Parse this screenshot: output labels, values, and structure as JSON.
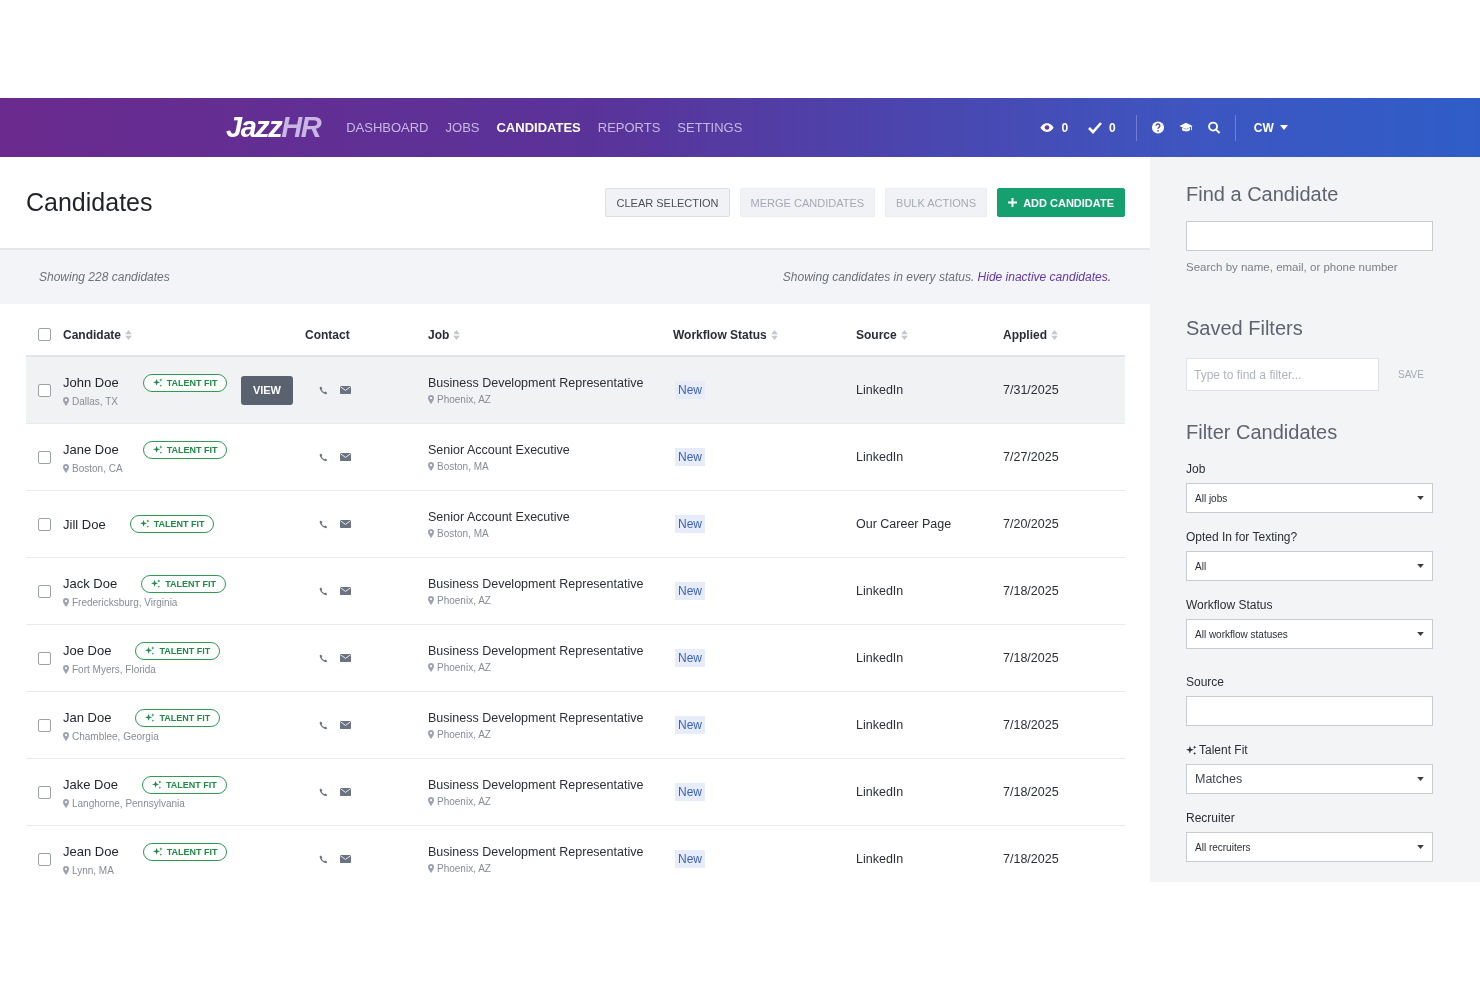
{
  "nav": {
    "logo": {
      "main": "Jazz",
      "accent": "HR"
    },
    "items": [
      {
        "label": "DASHBOARD",
        "selected": false
      },
      {
        "label": "JOBS",
        "selected": false
      },
      {
        "label": "CANDIDATES",
        "selected": true
      },
      {
        "label": "REPORTS",
        "selected": false
      },
      {
        "label": "SETTINGS",
        "selected": false
      }
    ],
    "counters": [
      {
        "kind": "eye",
        "count": "0"
      },
      {
        "kind": "check",
        "count": "0"
      }
    ],
    "tools": [
      {
        "kind": "help"
      },
      {
        "kind": "cap"
      },
      {
        "kind": "search"
      }
    ],
    "user": "CW"
  },
  "page": {
    "title": "Candidates",
    "actions": [
      {
        "label": "CLEAR SELECTION",
        "kind": "default",
        "disabled": false
      },
      {
        "label": "MERGE CANDIDATES",
        "kind": "default",
        "disabled": true
      },
      {
        "label": "BULK ACTIONS",
        "kind": "default",
        "disabled": true
      },
      {
        "label": "ADD CANDIDATE",
        "kind": "primary",
        "disabled": false
      }
    ],
    "count_text": "Showing 228 candidates",
    "status_note": "Showing candidates in every status.",
    "status_link": "Hide inactive candidates."
  },
  "table": {
    "select_all": {
      "checked": false
    },
    "columns": [
      {
        "label": "Candidate",
        "sortable": true
      },
      {
        "label": "Contact",
        "sortable": false
      },
      {
        "label": "Job",
        "sortable": true
      },
      {
        "label": "Workflow Status",
        "sortable": true
      },
      {
        "label": "Source",
        "sortable": true
      },
      {
        "label": "Applied",
        "sortable": true
      }
    ],
    "rows": [
      {
        "checked": false,
        "hovered": true,
        "name": "John Doe",
        "location": "Dallas, TX",
        "badge": "TALENT FIT",
        "action": "VIEW",
        "job": "Business Development Representative",
        "job_location": "Phoenix, AZ",
        "status": "New",
        "source": "LinkedIn",
        "applied": "7/31/2025"
      },
      {
        "checked": false,
        "hovered": false,
        "name": "Jane Doe",
        "location": "Boston, CA",
        "badge": "TALENT FIT",
        "job": "Senior Account Executive",
        "job_location": "Boston, MA",
        "status": "New",
        "source": "LinkedIn",
        "applied": "7/27/2025"
      },
      {
        "checked": false,
        "hovered": false,
        "name": "Jill Doe",
        "badge": "TALENT FIT",
        "job": "Senior Account Executive",
        "job_location": "Boston, MA",
        "status": "New",
        "source": "Our Career Page",
        "applied": "7/20/2025"
      },
      {
        "checked": false,
        "hovered": false,
        "name": "Jack Doe",
        "location": "Fredericksburg, Virginia",
        "badge": "TALENT FIT",
        "job": "Business Development Representative",
        "job_location": "Phoenix, AZ",
        "status": "New",
        "source": "LinkedIn",
        "applied": "7/18/2025"
      },
      {
        "checked": false,
        "hovered": false,
        "name": "Joe Doe",
        "location": "Fort Myers, Florida",
        "badge": "TALENT FIT",
        "job": "Business Development Representative",
        "job_location": "Phoenix, AZ",
        "status": "New",
        "source": "LinkedIn",
        "applied": "7/18/2025"
      },
      {
        "checked": false,
        "hovered": false,
        "name": "Jan Doe",
        "location": "Chamblee, Georgia",
        "badge": "TALENT FIT",
        "job": "Business Development Representative",
        "job_location": "Phoenix, AZ",
        "status": "New",
        "source": "LinkedIn",
        "applied": "7/18/2025"
      },
      {
        "checked": false,
        "hovered": false,
        "name": "Jake Doe",
        "location": "Langhorne, Pennsylvania",
        "badge": "TALENT FIT",
        "job": "Business Development Representative",
        "job_location": "Phoenix, AZ",
        "status": "New",
        "source": "LinkedIn",
        "applied": "7/18/2025"
      },
      {
        "checked": false,
        "hovered": false,
        "name": "Jean Doe",
        "location": "Lynn, MA",
        "badge": "TALENT FIT",
        "job": "Business Development Representative",
        "job_location": "Phoenix, AZ",
        "status": "New",
        "source": "LinkedIn",
        "applied": "7/18/2025"
      }
    ]
  },
  "sidebar": {
    "find": {
      "title": "Find a Candidate",
      "help": "Search by name, email, or phone number"
    },
    "saved": {
      "title": "Saved Filters",
      "placeholder": "Type to find a filter...",
      "action": "SAVE"
    },
    "filter_title": "Filter Candidates",
    "filters": [
      {
        "label": "Job",
        "kind": "select",
        "value": "All jobs"
      },
      {
        "label": "Opted In for Texting?",
        "kind": "select",
        "value": "All"
      },
      {
        "label": "Workflow Status",
        "kind": "select",
        "value": "All workflow statuses"
      },
      {
        "label": "Source",
        "kind": "text",
        "gap": true
      },
      {
        "label": "Talent Fit",
        "kind": "select",
        "value": "Matches",
        "ai": true
      },
      {
        "label": "Recruiter",
        "kind": "select",
        "value": "All recruiters"
      }
    ]
  }
}
